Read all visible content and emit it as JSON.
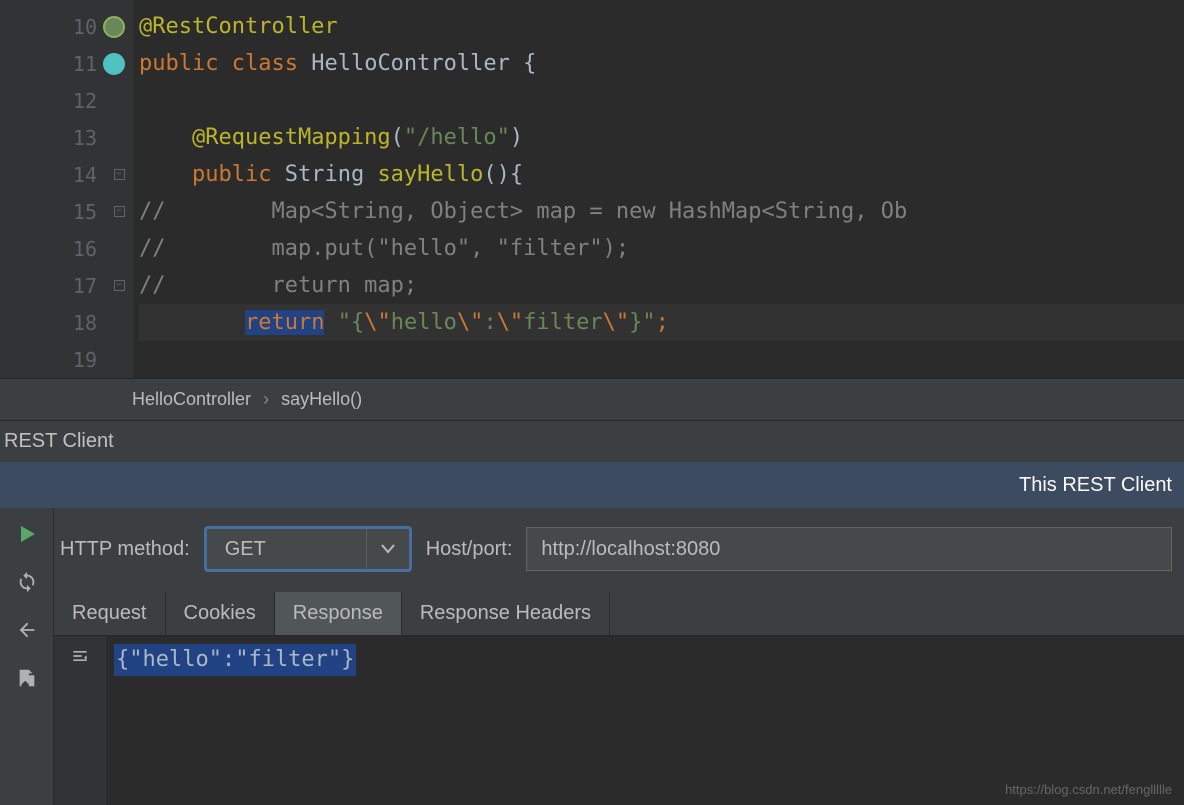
{
  "editor": {
    "lines": [
      {
        "num": "10",
        "icon": "green",
        "fold": "",
        "segments": [
          {
            "t": "@RestController",
            "c": "anno"
          }
        ]
      },
      {
        "num": "11",
        "icon": "blue",
        "fold": "",
        "segments": [
          {
            "t": "public",
            "c": "kw"
          },
          {
            "t": " ",
            "c": ""
          },
          {
            "t": "class",
            "c": "kw"
          },
          {
            "t": " HelloController {",
            "c": "cls"
          }
        ]
      },
      {
        "num": "12",
        "icon": "",
        "fold": "",
        "segments": []
      },
      {
        "num": "13",
        "icon": "",
        "fold": "",
        "segments": [
          {
            "t": "    ",
            "c": ""
          },
          {
            "t": "@RequestMapping",
            "c": "anno"
          },
          {
            "t": "(",
            "c": "cls"
          },
          {
            "t": "\"/hello\"",
            "c": "str"
          },
          {
            "t": ")",
            "c": "cls"
          }
        ]
      },
      {
        "num": "14",
        "icon": "",
        "fold": "minus",
        "segments": [
          {
            "t": "    ",
            "c": ""
          },
          {
            "t": "public",
            "c": "kw"
          },
          {
            "t": " String ",
            "c": "cls"
          },
          {
            "t": "sayHello",
            "c": "anno"
          },
          {
            "t": "(){",
            "c": "cls"
          }
        ]
      },
      {
        "num": "15",
        "icon": "",
        "fold": "minus",
        "segments": [
          {
            "t": "//        Map<String, Object> map = new HashMap<String, Ob",
            "c": "cmt"
          }
        ]
      },
      {
        "num": "16",
        "icon": "",
        "fold": "",
        "segments": [
          {
            "t": "//        map.put(\"hello\", \"filter\");",
            "c": "cmt"
          }
        ]
      },
      {
        "num": "17",
        "icon": "",
        "fold": "minus",
        "segments": [
          {
            "t": "//        return map;",
            "c": "cmt"
          }
        ]
      },
      {
        "num": "18",
        "icon": "",
        "fold": "",
        "hl": true,
        "segments": [
          {
            "t": "        ",
            "c": ""
          },
          {
            "t": "return",
            "c": "sel-kw"
          },
          {
            "t": " ",
            "c": ""
          },
          {
            "t": "\"{",
            "c": "str"
          },
          {
            "t": "\\\"",
            "c": "esc"
          },
          {
            "t": "hello",
            "c": "str"
          },
          {
            "t": "\\\"",
            "c": "esc"
          },
          {
            "t": ":",
            "c": "str"
          },
          {
            "t": "\\\"",
            "c": "esc"
          },
          {
            "t": "filter",
            "c": "str"
          },
          {
            "t": "\\\"",
            "c": "esc"
          },
          {
            "t": "}\"",
            "c": "str"
          },
          {
            "t": ";",
            "c": "kw"
          }
        ]
      },
      {
        "num": "19",
        "icon": "",
        "fold": "",
        "segments": []
      }
    ]
  },
  "breadcrumb": {
    "class": "HelloController",
    "method": "sayHello()"
  },
  "panel": {
    "title": "REST Client",
    "notice": "This REST Client",
    "method_label": "HTTP method:",
    "method_value": "GET",
    "host_label": "Host/port:",
    "host_value": "http://localhost:8080",
    "tabs": [
      "Request",
      "Cookies",
      "Response",
      "Response Headers"
    ],
    "active_tab": 2,
    "response": "{\"hello\":\"filter\"}"
  },
  "watermark": "https://blog.csdn.net/fengllllle"
}
